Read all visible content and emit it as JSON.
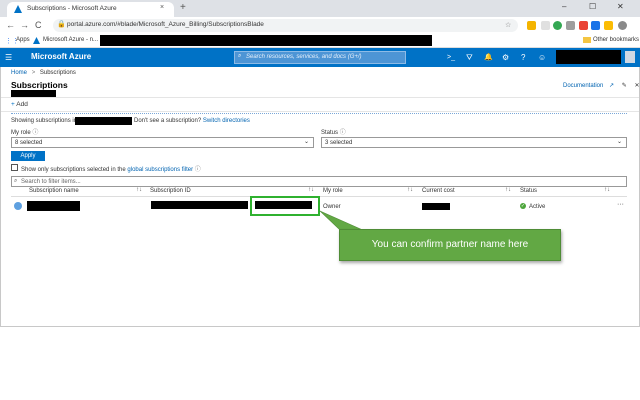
{
  "browser": {
    "tab_title": "Subscriptions - Microsoft Azure",
    "tab_close": "×",
    "new_tab": "+",
    "url": "portal.azure.com/#blade/Microsoft_Azure_Billing/SubscriptionsBlade",
    "nav": {
      "back": "←",
      "forward": "→",
      "reload": "C"
    },
    "window": {
      "minimize": "–",
      "maximize": "☐",
      "close": "✕"
    },
    "bookmarks": {
      "apps": "Apps",
      "azure": "Microsoft Azure - n...",
      "other": "Other bookmarks"
    },
    "colors": {
      "chrome_bg": "#dee1e6",
      "omnibox": "#f1f3f4"
    }
  },
  "azure": {
    "brand": "Microsoft Azure",
    "search_placeholder": "Search resources, services, and docs (G+/)",
    "header_color": "#0072c6",
    "header_icons": [
      "cloud-shell-icon",
      "directory-filter-icon",
      "notifications-icon",
      "settings-icon",
      "help-icon",
      "feedback-icon"
    ],
    "glyphs": {
      "shell": ">_",
      "filter": "⛛",
      "bell": "🔔",
      "gear": "⚙",
      "help": "?",
      "smile": "☺"
    }
  },
  "breadcrumb": {
    "home": "Home",
    "separator": ">",
    "current": "Subscriptions"
  },
  "page": {
    "title": "Subscriptions",
    "documentation": "Documentation",
    "add": "Add"
  },
  "filters": {
    "showing_prefix": "Showing subscriptions in",
    "dont_see": "Don't see a subscription?",
    "switch_dirs": "Switch directories",
    "my_role_label": "My role",
    "my_role_value": "8 selected",
    "status_label": "Status",
    "status_value": "3 selected",
    "apply": "Apply",
    "only_selected": "Show only subscriptions selected in the",
    "global_filter": "global subscriptions filter",
    "filter_placeholder": "Search to filter items..."
  },
  "table": {
    "headers": [
      "Subscription name",
      "Subscription ID",
      "My role",
      "Current cost",
      "Status"
    ],
    "rows": [
      {
        "my_role": "Owner",
        "status": "Active",
        "more": "···"
      }
    ]
  },
  "callout": {
    "text": "You can confirm partner name here",
    "color": "#62a844"
  },
  "highlight_color": "#2fb12f"
}
